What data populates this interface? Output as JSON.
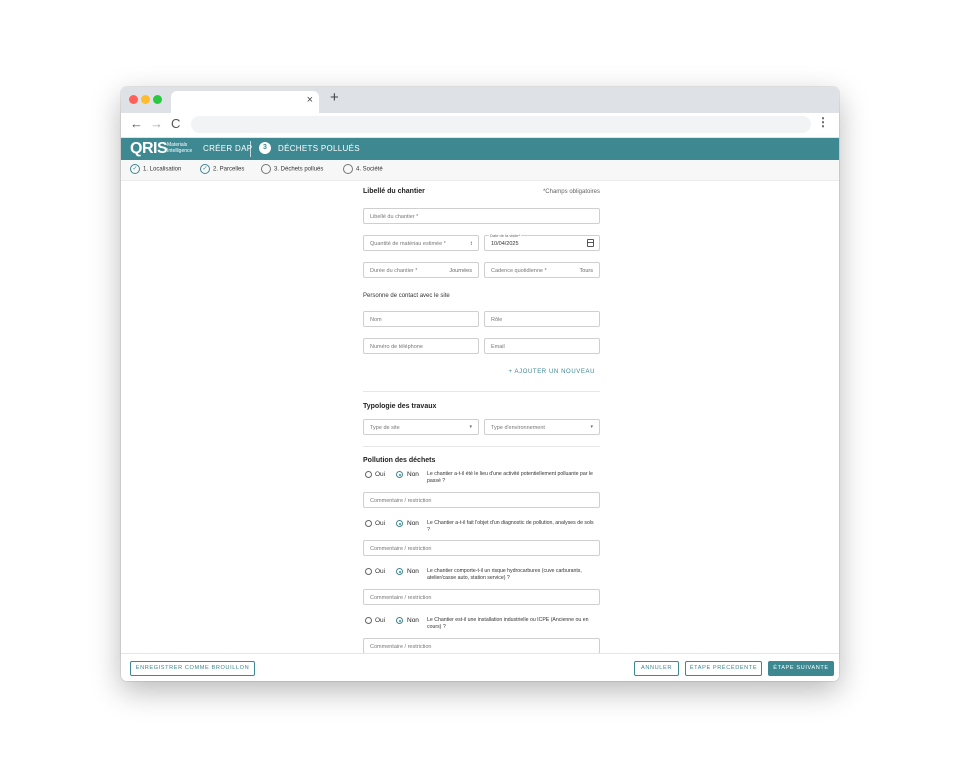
{
  "browser": {
    "tab_close": "×",
    "new_tab": "+",
    "back": "←",
    "forward": "→",
    "reload": "C",
    "menu": "⋮"
  },
  "app": {
    "logo": "QRIS",
    "logo_sub_1": "Materials",
    "logo_sub_2": "Intelligence",
    "create_label": "CRÉER DAP",
    "current_step_number": "3",
    "current_step_label": "DÉCHETS POLLUÉS",
    "accent_color": "#3d8891"
  },
  "stepper": [
    {
      "label": "1. Localisation",
      "state": "done"
    },
    {
      "label": "2. Parcelles",
      "state": "done"
    },
    {
      "label": "3. Déchets pollués",
      "state": "todo"
    },
    {
      "label": "4. Société",
      "state": "todo"
    }
  ],
  "form": {
    "section1_title": "Libellé du chantier",
    "required_note": "*Champs obligatoires",
    "libelle_placeholder": "Libellé du chantier *",
    "quantite_placeholder": "Quantité de matériau estimée *",
    "quantite_unit": "t",
    "date_label": "Date de la visite*",
    "date_value": "10/04/2025",
    "duree_placeholder": "Durée du chantier *",
    "duree_unit": "Journées",
    "cadence_placeholder": "Cadence quotidienne *",
    "cadence_unit": "Tours",
    "contact_title": "Personne de contact avec le site",
    "nom_placeholder": "Nom",
    "role_placeholder": "Rôle",
    "tel_placeholder": "Numéro de téléphone",
    "email_placeholder": "Email",
    "add_new": "+ AJOUTER UN NOUVEAU",
    "section2_title": "Typologie des travaux",
    "type_site": "Type de site",
    "type_env": "Type d'environnement",
    "caret": "▾",
    "section3_title": "Pollution des déchets",
    "oui": "Oui",
    "non": "Non",
    "comment_placeholder": "Commentaire / restriction",
    "questions": [
      {
        "text": "Le chantier a-t-il été le lieu d'une activité potentiellement polluante par le passé ?",
        "selected": "non"
      },
      {
        "text": "Le Chantier a-t-il fait l'objet d'un diagnostic de pollution, analyses de sols ?",
        "selected": "non"
      },
      {
        "text": "Le chantier comporte-t-il un risque hydrocarbures (cuve carburants, atelier/casse auto, station service) ?",
        "selected": "non"
      },
      {
        "text": "Le Chantier est-il une installation industrielle ou ICPE (Ancienne ou en cours) ?",
        "selected": "non"
      }
    ]
  },
  "footer": {
    "draft": "ENREGISTRER COMME BROUILLON",
    "cancel": "ANNULER",
    "prev": "ÉTAPE PRÉCÉDENTE",
    "next": "ÉTAPE SUIVANTE"
  }
}
